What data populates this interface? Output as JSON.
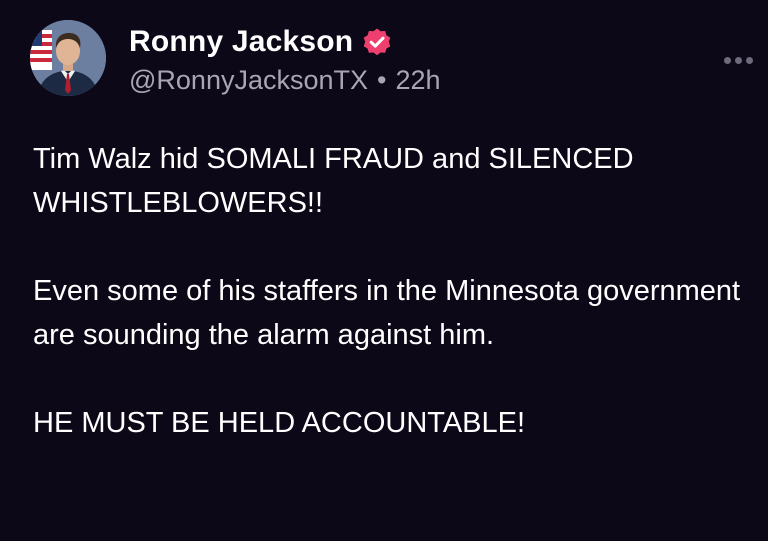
{
  "author": {
    "display_name": "Ronny Jackson",
    "handle": "@RonnyJacksonTX",
    "separator": "•",
    "time": "22h",
    "verified_icon": "verified-badge-icon",
    "verified_color": "#ef3f6e"
  },
  "menu": {
    "icon": "more-options-icon"
  },
  "post": {
    "paragraphs": [
      "Tim Walz hid SOMALI FRAUD and SILENCED WHISTLEBLOWERS!!",
      "Even some of his staffers in the Minnesota government are sounding the alarm against him.",
      "HE MUST BE HELD ACCOUNTABLE!"
    ]
  },
  "colors": {
    "background": "#0c0817",
    "text": "#ffffff",
    "secondary_text": "#a9a6b3"
  }
}
